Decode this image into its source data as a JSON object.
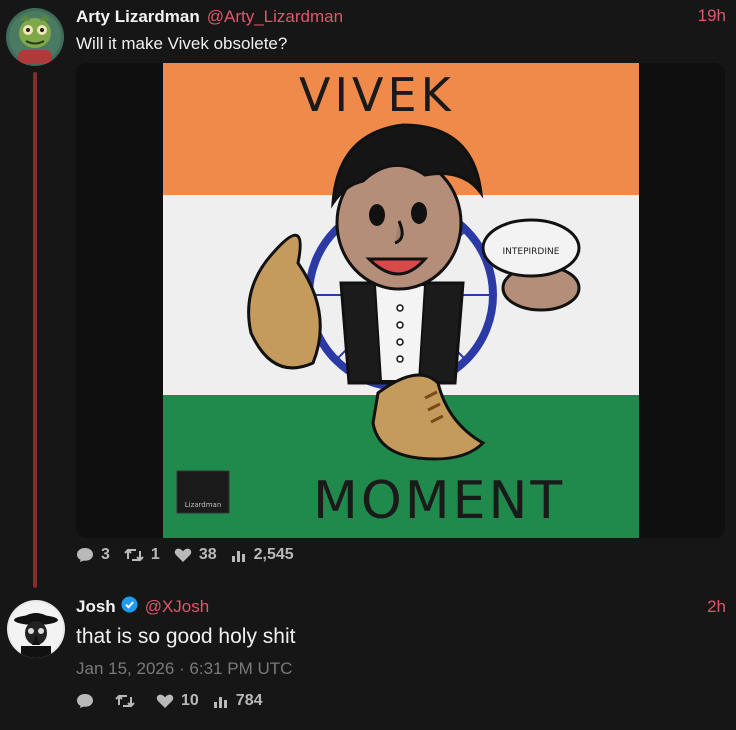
{
  "tweet": {
    "author_name": "Arty Lizardman",
    "author_handle": "@Arty_Lizardman",
    "time": "19h",
    "text": "Will it make Vivek obsolete?",
    "image": {
      "title_top": "VIVEK",
      "title_bottom": "MOMENT",
      "pill_label": "INTEPIRDINE",
      "signature": "Lizardman"
    },
    "stats": {
      "replies": "3",
      "reposts": "1",
      "likes": "38",
      "views": "2,545"
    }
  },
  "reply": {
    "author_name": "Josh",
    "author_handle": "@XJosh",
    "time": "2h",
    "text": "that is so good holy shit",
    "timestamp": "Jan 15, 2026 · 6:31 PM UTC",
    "stats": {
      "likes": "10",
      "views": "784"
    }
  },
  "colors": {
    "accent": "#e0566b",
    "thread_line": "#8b2a2a",
    "flag_saffron": "#f08a4b",
    "flag_green": "#1f8a4c",
    "chakra_blue": "#2c3aa6"
  },
  "icons": [
    "comment-icon",
    "repost-icon",
    "heart-icon",
    "views-icon",
    "verified-badge-icon"
  ]
}
